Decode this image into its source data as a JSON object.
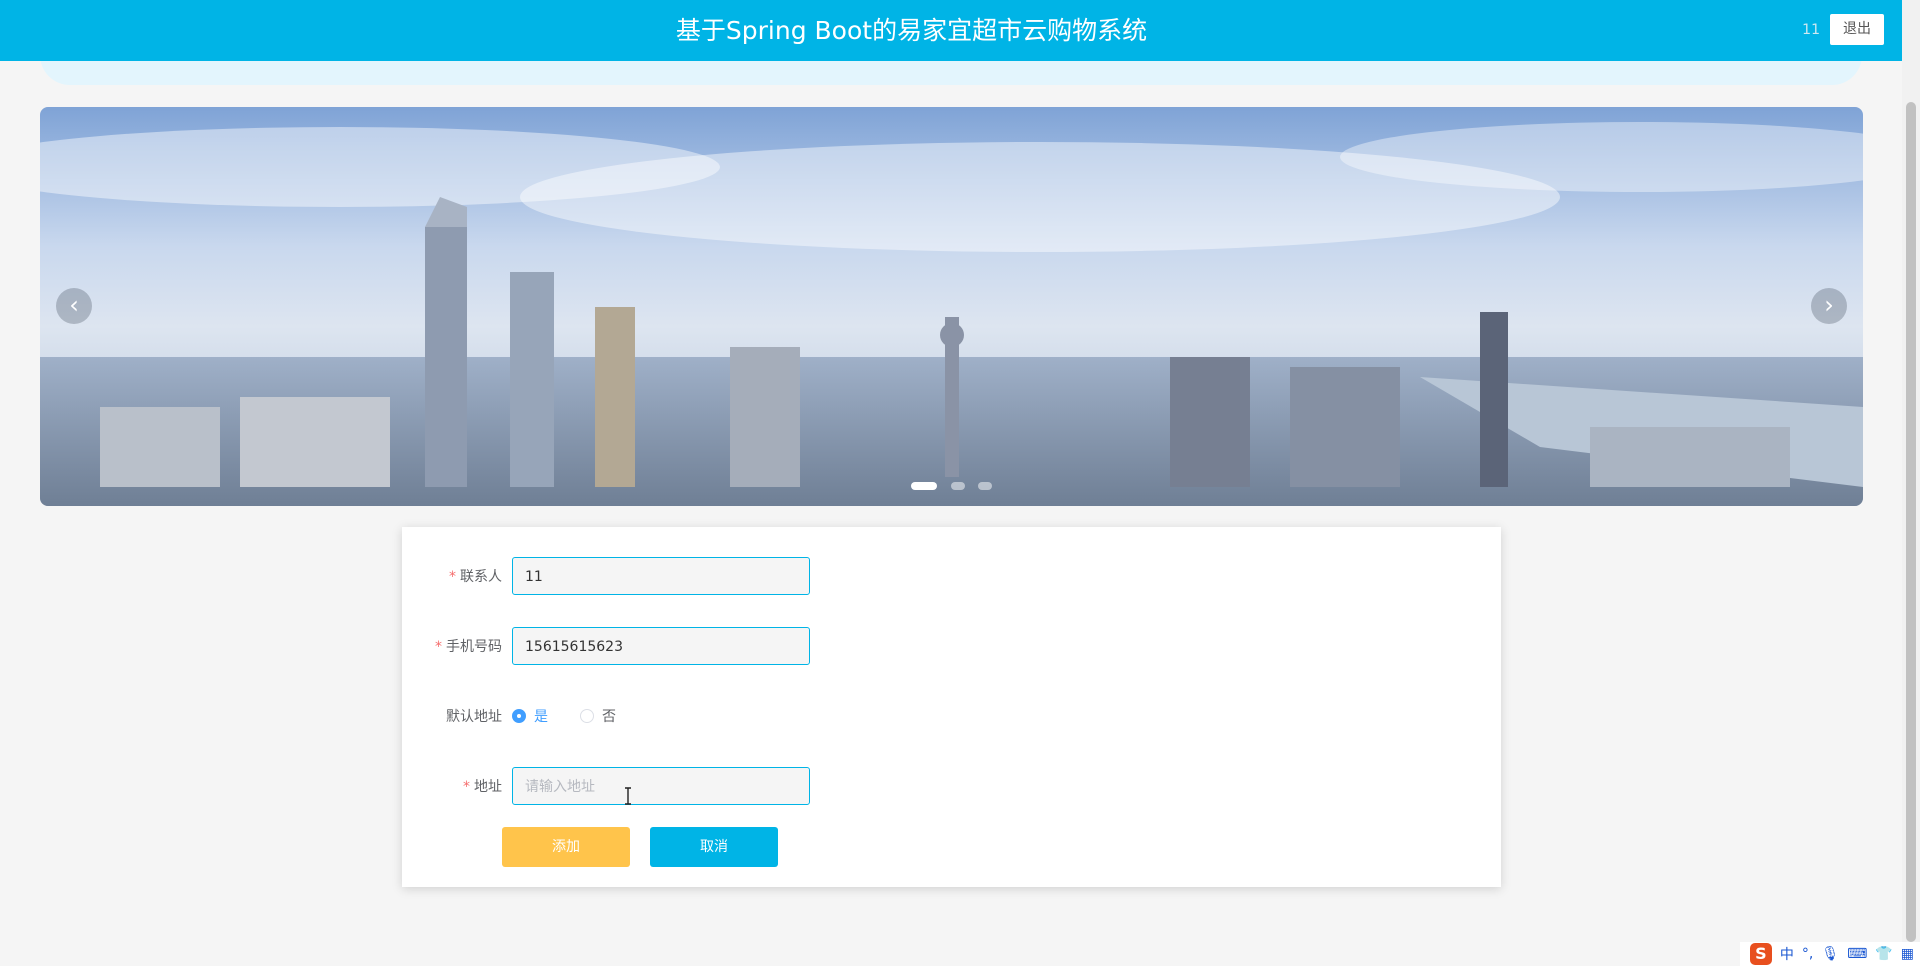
{
  "header": {
    "title": "基于Spring Boot的易家宜超市云购物系统",
    "username": "11",
    "logout_label": "退出"
  },
  "banner": {
    "prev_label": "‹",
    "next_label": "›",
    "slide_count": 3,
    "active_slide": 1
  },
  "form": {
    "contact": {
      "label": "联系人",
      "value": "11",
      "required": true
    },
    "phone": {
      "label": "手机号码",
      "value": "15615615623",
      "required": true
    },
    "default_address": {
      "label": "默认地址",
      "options": [
        "是",
        "否"
      ],
      "selected": "是"
    },
    "address": {
      "label": "地址",
      "value": "",
      "placeholder": "请输入地址",
      "required": true
    },
    "add_label": "添加",
    "cancel_label": "取消"
  },
  "ime": {
    "logo": "S",
    "lang": "中",
    "punct": "°,"
  },
  "colors": {
    "primary": "#00b4e6",
    "add_button": "#ffc44b",
    "radio_checked": "#409eff",
    "required": "#f56c6c"
  },
  "icons": [
    "chevron-left-icon",
    "chevron-right-icon",
    "text-cursor-icon",
    "microphone-icon",
    "keyboard-icon",
    "shirt-icon",
    "grid-icon"
  ]
}
